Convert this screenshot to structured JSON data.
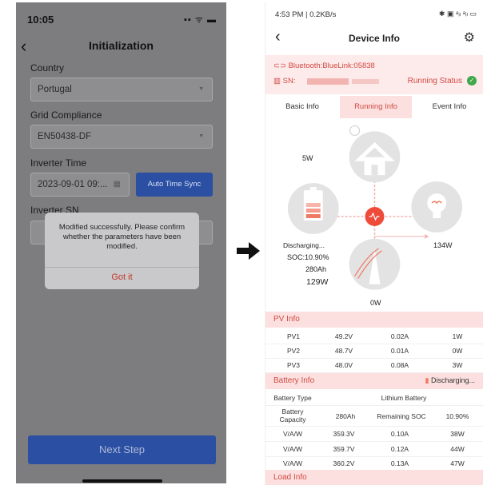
{
  "left": {
    "status_time": "10:05",
    "status_icons": "▪▪ ᯤ ▬",
    "nav_title": "Initialization",
    "country_label": "Country",
    "country_value": "Portugal",
    "grid_label": "Grid Compliance",
    "grid_value": "EN50438-DF",
    "time_label": "Inverter Time",
    "time_value": "2023-09-01 09:...",
    "sync_button": "Auto Time Sync",
    "sn_label": "Inverter SN",
    "dialog_message": "Modified successfully. Please confirm whether the parameters have been modified.",
    "dialog_button": "Got it",
    "next_button": "Next Step"
  },
  "right": {
    "status_time": "4:53 PM | 0.2KB/s",
    "status_icons": "✱ ▣ ᵃᵢₗ ᵃᵢₗ ▭",
    "title": "Device Info",
    "bluetooth": "Bluetooth:BlueLink:05838",
    "sn_label": "SN:",
    "running_status": "Running Status",
    "tabs": [
      "Basic Info",
      "Running Info",
      "Event Info"
    ],
    "flow": {
      "pv_power": "5W",
      "load_power": "134W",
      "grid_power": "0W",
      "battery_state": "Discharging...",
      "battery_soc": "SOC:10.90%",
      "battery_capacity": "280Ah",
      "battery_power": "129W"
    },
    "pv_info": {
      "title": "PV Info",
      "rows": [
        [
          "PV1",
          "49.2V",
          "0.02A",
          "1W"
        ],
        [
          "PV2",
          "48.7V",
          "0.01A",
          "0W"
        ],
        [
          "PV3",
          "48.0V",
          "0.08A",
          "3W"
        ]
      ]
    },
    "battery_info": {
      "title": "Battery Info",
      "state": "Discharging...",
      "type_label": "Battery Type",
      "type_value": "Lithium Battery",
      "capacity_label": "Battery Capacity",
      "capacity_value": "280Ah",
      "soc_label": "Remaining SOC",
      "soc_value": "10.90%",
      "rows": [
        [
          "V/A/W",
          "359.3V",
          "0.10A",
          "38W"
        ],
        [
          "V/A/W",
          "359.7V",
          "0.12A",
          "44W"
        ],
        [
          "V/A/W",
          "360.2V",
          "0.13A",
          "47W"
        ]
      ]
    },
    "load_info": {
      "title": "Load Info"
    }
  }
}
